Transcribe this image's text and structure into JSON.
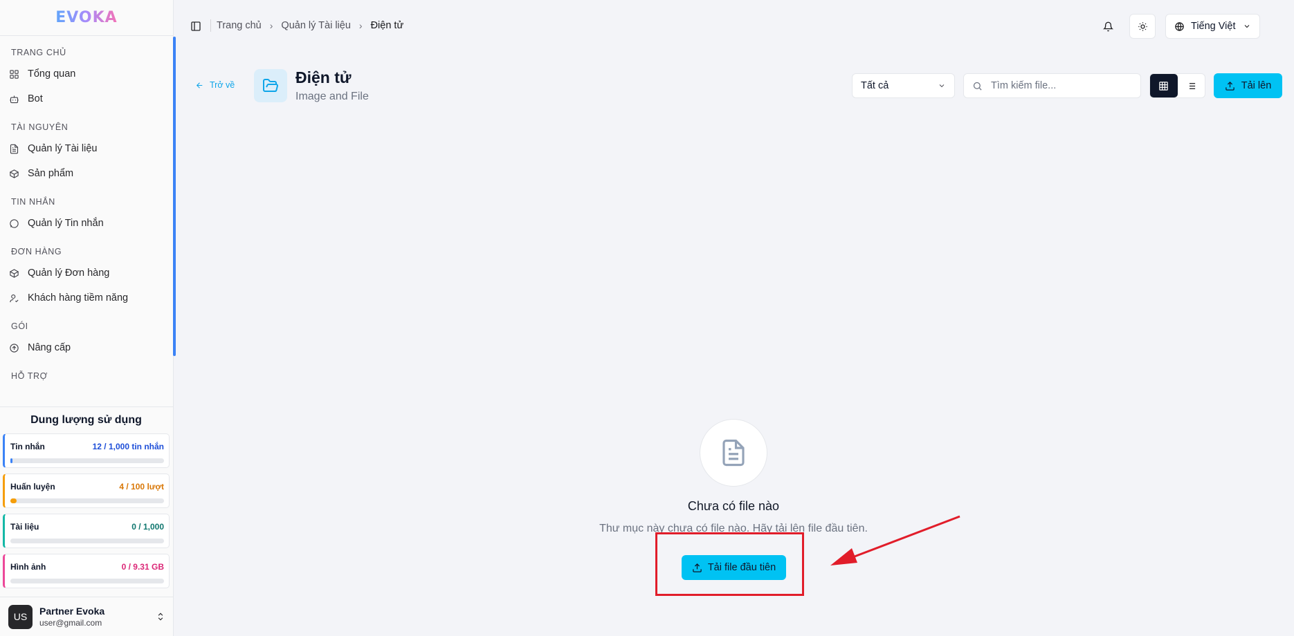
{
  "logo": "EVOKA",
  "sidebar": {
    "sections": [
      {
        "label": "TRANG CHỦ",
        "items": [
          {
            "label": "Tổng quan",
            "icon": "grid-icon"
          },
          {
            "label": "Bot",
            "icon": "bot-icon"
          }
        ]
      },
      {
        "label": "TÀI NGUYÊN",
        "items": [
          {
            "label": "Quản lý Tài liệu",
            "icon": "file-icon"
          },
          {
            "label": "Sản phẩm",
            "icon": "box-icon"
          }
        ]
      },
      {
        "label": "TIN NHẮN",
        "items": [
          {
            "label": "Quản lý Tin nhắn",
            "icon": "chat-icon"
          }
        ]
      },
      {
        "label": "ĐƠN HÀNG",
        "items": [
          {
            "label": "Quản lý Đơn hàng",
            "icon": "box-icon"
          },
          {
            "label": "Khách hàng tiềm năng",
            "icon": "user-icon"
          }
        ]
      },
      {
        "label": "GÓI",
        "items": [
          {
            "label": "Nâng cấp",
            "icon": "arrow-up-circle-icon"
          }
        ]
      },
      {
        "label": "HỖ TRỢ",
        "items": []
      }
    ]
  },
  "usage": {
    "title": "Dung lượng sử dụng",
    "cards": [
      {
        "label": "Tin nhắn",
        "value": "12 / 1,000 tin nhắn",
        "fraction": 0.012,
        "color": "#3b82f6",
        "text_color": "#1d4ed8"
      },
      {
        "label": "Huấn luyện",
        "value": "4 / 100 lượt",
        "fraction": 0.04,
        "color": "#f59e0b",
        "text_color": "#d97706"
      },
      {
        "label": "Tài liệu",
        "value": "0 / 1,000",
        "fraction": 0,
        "color": "#14b8a6",
        "text_color": "#0f766e"
      },
      {
        "label": "Hình ảnh",
        "value": "0 / 9.31 GB",
        "fraction": 0,
        "color": "#ec4899",
        "text_color": "#db2777"
      }
    ]
  },
  "user": {
    "initials": "US",
    "name": "Partner Evoka",
    "email": "user@gmail.com"
  },
  "breadcrumb": [
    "Trang chủ",
    "Quản lý Tài liệu",
    "Điện tử"
  ],
  "language": "Tiếng Việt",
  "header": {
    "back": "Trở về",
    "title": "Điện tử",
    "subtitle": "Image and File",
    "filter": "Tất cả",
    "search_placeholder": "Tìm kiếm file...",
    "upload": "Tải lên"
  },
  "empty": {
    "title": "Chưa có file nào",
    "desc": "Thư mục này chưa có file nào. Hãy tải lên file đầu tiên.",
    "button": "Tải file đầu tiên"
  },
  "colors": {
    "accent": "#00c2f3",
    "annotation": "#e11d2a",
    "scroll": "#3b82f6"
  }
}
